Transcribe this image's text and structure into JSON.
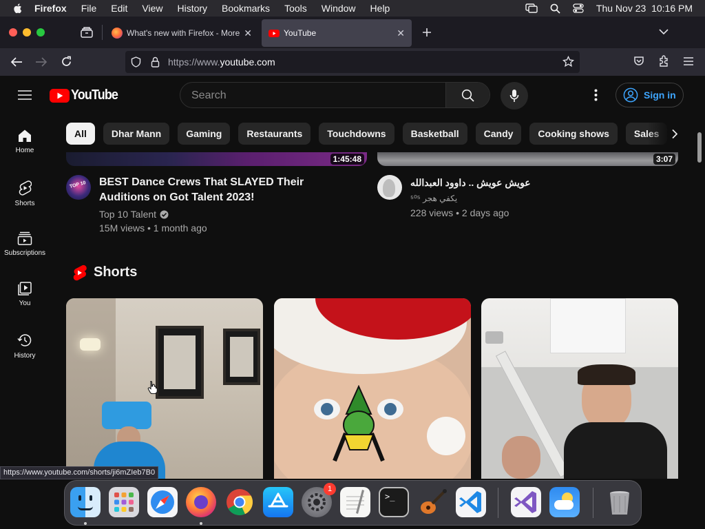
{
  "menubar": {
    "items": [
      "Firefox",
      "File",
      "Edit",
      "View",
      "History",
      "Bookmarks",
      "Tools",
      "Window",
      "Help"
    ],
    "datetime": "Thu Nov 23  10:16 PM"
  },
  "tabs": [
    {
      "title": "What's new with Firefox - More"
    },
    {
      "title": "YouTube"
    }
  ],
  "url": {
    "prefix": "https://www.",
    "domain": "youtube.com"
  },
  "yt": {
    "logo_text": "YouTube",
    "search_placeholder": "Search",
    "signin_label": "Sign in"
  },
  "chips": [
    "All",
    "Dhar Mann",
    "Gaming",
    "Restaurants",
    "Touchdowns",
    "Basketball",
    "Candy",
    "Cooking shows",
    "Sales"
  ],
  "sidebar": [
    {
      "label": "Home",
      "icon": "home-icon"
    },
    {
      "label": "Shorts",
      "icon": "shorts-icon"
    },
    {
      "label": "Subscriptions",
      "icon": "subscriptions-icon"
    },
    {
      "label": "You",
      "icon": "you-icon"
    },
    {
      "label": "History",
      "icon": "history-icon"
    }
  ],
  "videos": [
    {
      "title": "BEST Dance Crews That SLAYED Their Auditions on Got Talent 2023!",
      "channel": "Top 10 Talent",
      "stats": "15M views • 1 month ago",
      "duration": "1:45:48"
    },
    {
      "title": "عويش عويش .. داوود العبدالله",
      "channel": "يكفي هجر ⁵⁰⁵",
      "stats": "228 views • 2 days ago",
      "duration": "3:07"
    }
  ],
  "shorts": {
    "title": "Shorts"
  },
  "status_url": "https://www.youtube.com/shorts/ji6mZIeb7B0",
  "dock": {
    "apps": [
      "Finder",
      "Launchpad",
      "Safari",
      "Firefox",
      "Chrome",
      "App Store",
      "System Settings",
      "TextEdit",
      "Terminal",
      "GarageBand",
      "VS Code",
      "Visual Studio",
      "Weather",
      "Trash"
    ],
    "settings_badge": "1"
  },
  "colors": {
    "yt_red": "#ff0000",
    "link_blue": "#3ea6ff",
    "bg": "#0f0f0f"
  }
}
